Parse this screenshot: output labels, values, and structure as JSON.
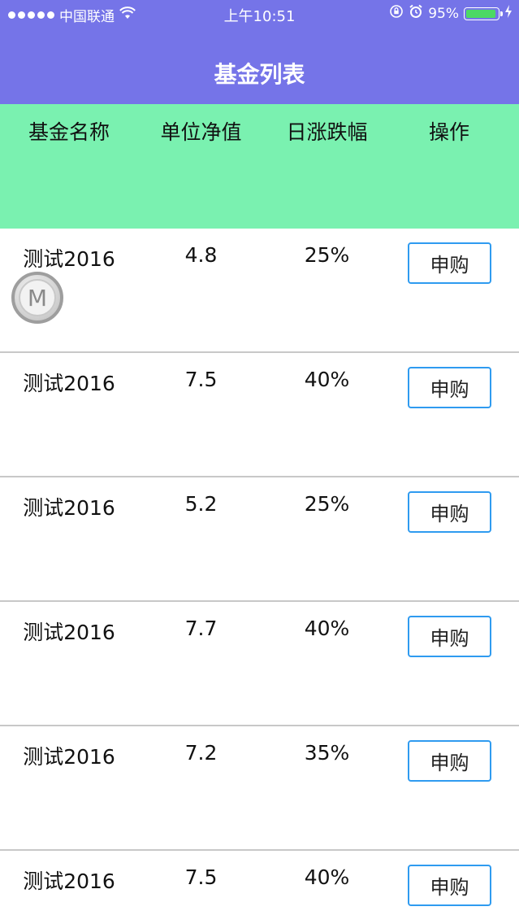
{
  "status_bar": {
    "carrier": "中国联通",
    "time": "上午10:51",
    "battery_percent": "95%",
    "battery_level": 0.95,
    "icons": [
      "signal-dots-icon",
      "wifi-icon",
      "rotation-lock-icon",
      "alarm-icon",
      "battery-icon",
      "charging-icon"
    ]
  },
  "nav": {
    "title": "基金列表",
    "background_color": "#7574e8"
  },
  "table": {
    "header_background": "#7af1b0",
    "columns": [
      "基金名称",
      "单位净值",
      "日涨跌幅",
      "操作"
    ],
    "rows": [
      {
        "name": "测试2016",
        "nav": "4.8",
        "change": "25%",
        "action": "申购"
      },
      {
        "name": "测试2016",
        "nav": "7.5",
        "change": "40%",
        "action": "申购"
      },
      {
        "name": "测试2016",
        "nav": "5.2",
        "change": "25%",
        "action": "申购"
      },
      {
        "name": "测试2016",
        "nav": "7.7",
        "change": "40%",
        "action": "申购"
      },
      {
        "name": "测试2016",
        "nav": "7.2",
        "change": "35%",
        "action": "申购"
      },
      {
        "name": "测试2016",
        "nav": "7.5",
        "change": "40%",
        "action": "申购"
      }
    ]
  },
  "floating_button": {
    "label": "M"
  }
}
